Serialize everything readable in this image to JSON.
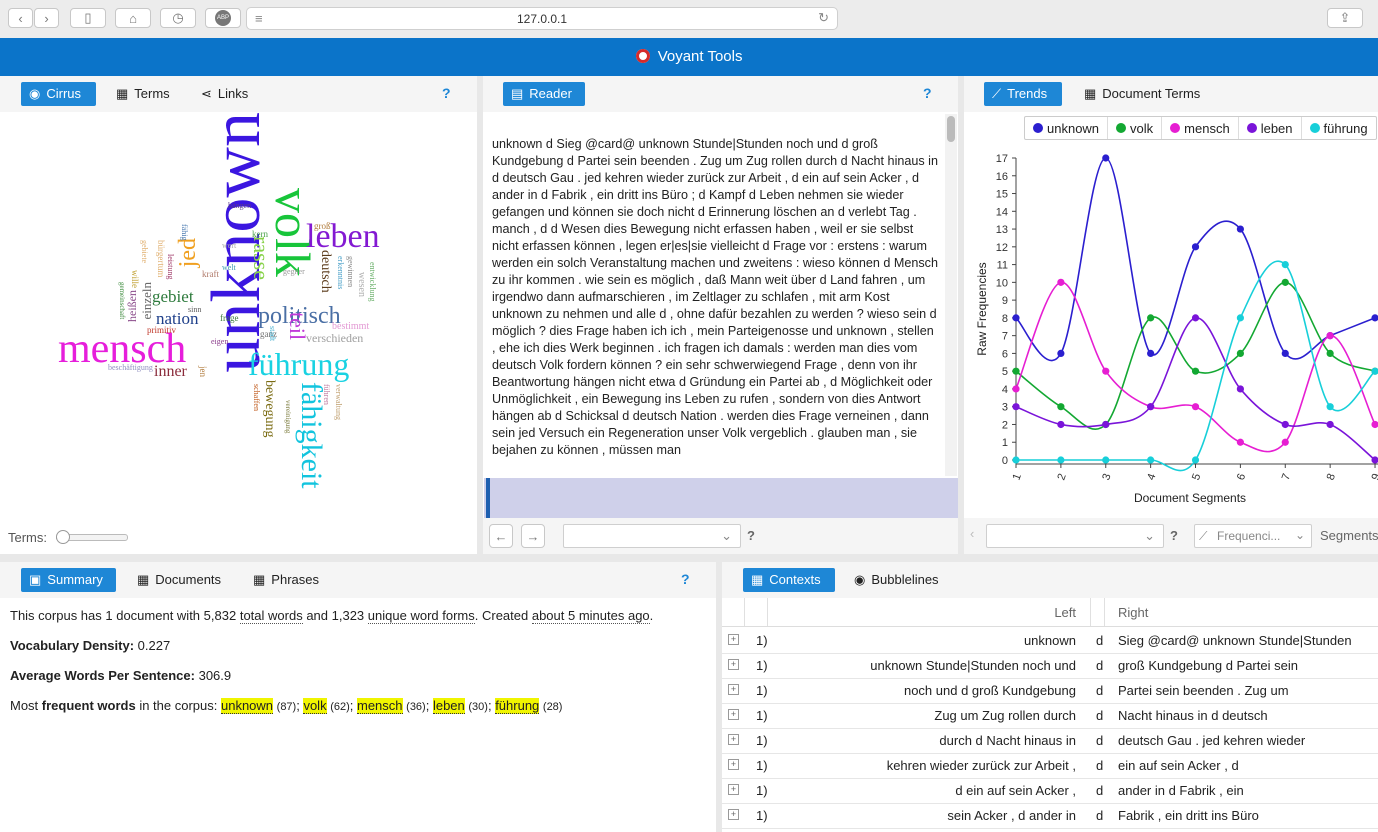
{
  "browser": {
    "url": "127.0.0.1",
    "abp": "ABP"
  },
  "app": {
    "title": "Voyant Tools"
  },
  "left_panel": {
    "tabs": [
      {
        "label": "Cirrus"
      },
      {
        "label": "Terms"
      },
      {
        "label": "Links"
      }
    ],
    "help": "?",
    "terms_label": "Terms:",
    "slider_value": 0.05
  },
  "cirrus_words": [
    "unknown",
    "volk",
    "mensch",
    "leben",
    "führung",
    "fähigkeit",
    "jed",
    "politisch",
    "rasse",
    "teil",
    "gebiet",
    "nation",
    "deutsch",
    "inner",
    "bewegung",
    "verschieden",
    "bestimmt",
    "groß",
    "frage",
    "kern",
    "gegner",
    "erkenntnis",
    "einzeln",
    "heißen",
    "primitiv",
    "eigen",
    "kraft",
    "welt",
    "wert",
    "hängen",
    "fähig",
    "leistung",
    "bürgertum",
    "gebiete",
    "wille",
    "gemeinschaft",
    "sinn",
    "ganz",
    "jen",
    "schaffen",
    "stadt",
    "wesen",
    "gewinnen",
    "entwicklung",
    "führen",
    "verwaltung",
    "vereinigung",
    "beschäftigung"
  ],
  "reader": {
    "tab": "Reader",
    "help": "?",
    "text": "unknown d Sieg @card@ unknown Stunde|Stunden noch und d groß Kundgebung d Partei sein beenden . Zug um Zug rollen durch d Nacht hinaus in d deutsch Gau . jed kehren wieder zurück zur Arbeit , d ein auf sein Acker , d ander in d Fabrik , ein dritt ins Büro ; d Kampf d Leben nehmen sie wieder gefangen und können sie doch nicht d Erinnerung löschen an d verlebt Tag . manch , d d Wesen dies Bewegung nicht erfassen haben , weil er sie selbst nicht erfassen können , legen er|es|sie vielleicht d Frage vor : erstens : warum werden ein solch Veranstaltung machen und zweitens : wieso können d Mensch zu ihr kommen . wie sein es möglich , daß Mann weit über d Land fahren , um irgendwo dann aufmarschieren , im Zeltlager zu schlafen , mit arm Kost unknown zu nehmen und alle d , ohne dafür bezahlen zu werden ? wieso sein d möglich ? dies Frage haben ich ich , mein Parteigenosse und unknown , stellen , ehe ich dies Werk beginnen . ich fragen ich damals : werden man dies vom deutsch Volk fordern können ? ein sehr schwerwiegend Frage , denn von ihr Beantwortung hängen nicht etwa d Gründung ein Partei ab , d Möglichkeit oder Unmöglichkeit , ein Bewegung ins Leben zu rufen , sondern von dies Antwort hängen ab d Schicksal d deutsch Nation . werden dies Frage verneinen , dann sein jed Versuch ein Regeneration unser Volk vergeblich . glauben man , sie bejahen zu können , müssen man",
    "help2": "?"
  },
  "trends": {
    "tabs": [
      {
        "label": "Trends"
      },
      {
        "label": "Document Terms"
      }
    ],
    "footer": {
      "mode": "Frequenci...",
      "segments_label": "Segments",
      "help": "?"
    }
  },
  "chart_data": {
    "type": "line",
    "xlabel": "Document Segments",
    "ylabel": "Raw Frequencies",
    "x": [
      1,
      2,
      3,
      4,
      5,
      6,
      7,
      8,
      9
    ],
    "ylim": [
      0,
      17
    ],
    "yticks": [
      0,
      1,
      2,
      3,
      4,
      5,
      6,
      7,
      8,
      9,
      10,
      11,
      12,
      13,
      14,
      15,
      16,
      17
    ],
    "legend_position": "top",
    "series": [
      {
        "name": "unknown",
        "color": "#2b1fcf",
        "values": [
          8,
          6,
          17,
          6,
          12,
          13,
          6,
          7,
          8
        ]
      },
      {
        "name": "volk",
        "color": "#13a832",
        "values": [
          5,
          3,
          2,
          8,
          5,
          6,
          10,
          6,
          5
        ]
      },
      {
        "name": "mensch",
        "color": "#e61ed2",
        "values": [
          4,
          10,
          5,
          3,
          3,
          1,
          1,
          7,
          2
        ]
      },
      {
        "name": "leben",
        "color": "#7a14d9",
        "values": [
          3,
          2,
          2,
          3,
          8,
          4,
          2,
          2,
          0
        ]
      },
      {
        "name": "führung",
        "color": "#17cfd9",
        "values": [
          0,
          0,
          0,
          0,
          0,
          8,
          11,
          3,
          5
        ]
      }
    ]
  },
  "summary": {
    "tabs": [
      {
        "label": "Summary"
      },
      {
        "label": "Documents"
      },
      {
        "label": "Phrases"
      }
    ],
    "help": "?",
    "line1_a": "This corpus has 1 document with ",
    "line1_total": "5,832",
    "line1_total_label": "total words",
    "line1_b": " and ",
    "line1_unique": "1,323",
    "line1_unique_label": "unique word forms",
    "line1_c": ". Created ",
    "line1_time": "about 5 minutes ago",
    "line1_d": ".",
    "density_label": "Vocabulary Density:",
    "density_value": "0.227",
    "awps_label": "Average Words Per Sentence:",
    "awps_value": "306.9",
    "freq_a": "Most ",
    "freq_b": "frequent words",
    "freq_c": " in the corpus: ",
    "freq_words": [
      {
        "word": "unknown",
        "count": "(87)"
      },
      {
        "word": "volk",
        "count": "(62)"
      },
      {
        "word": "mensch",
        "count": "(36)"
      },
      {
        "word": "leben",
        "count": "(30)"
      },
      {
        "word": "führung",
        "count": "(28)"
      }
    ]
  },
  "contexts": {
    "tabs": [
      {
        "label": "Contexts"
      },
      {
        "label": "Bubblelines"
      }
    ],
    "headers": {
      "left": "Left",
      "right": "Right"
    },
    "rows": [
      {
        "doc": "1)",
        "left": "unknown",
        "term": "d",
        "right": "Sieg @card@ unknown Stunde|Stunden"
      },
      {
        "doc": "1)",
        "left": "unknown Stunde|Stunden noch und",
        "term": "d",
        "right": "groß Kundgebung d Partei sein"
      },
      {
        "doc": "1)",
        "left": "noch und d groß Kundgebung",
        "term": "d",
        "right": "Partei sein beenden . Zug um"
      },
      {
        "doc": "1)",
        "left": "Zug um Zug rollen durch",
        "term": "d",
        "right": "Nacht hinaus in d deutsch"
      },
      {
        "doc": "1)",
        "left": "durch d Nacht hinaus in",
        "term": "d",
        "right": "deutsch Gau . jed kehren wieder"
      },
      {
        "doc": "1)",
        "left": "kehren wieder zurück zur Arbeit ,",
        "term": "d",
        "right": "ein auf sein Acker , d"
      },
      {
        "doc": "1)",
        "left": "d ein auf sein Acker ,",
        "term": "d",
        "right": "ander in d Fabrik , ein"
      },
      {
        "doc": "1)",
        "left": "sein Acker , d ander in",
        "term": "d",
        "right": "Fabrik , ein dritt ins Büro"
      }
    ]
  }
}
